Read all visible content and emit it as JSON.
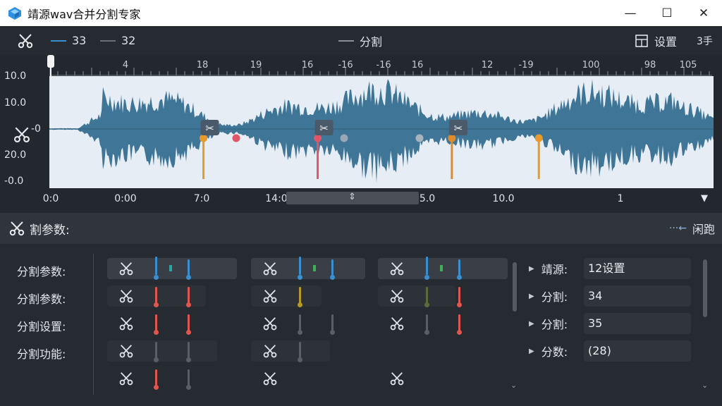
{
  "window": {
    "title": "靖源wav合并分割专家",
    "minimize": "—",
    "maximize": "☐",
    "close": "✕"
  },
  "toolbar": {
    "track_a": "33",
    "track_b": "32",
    "mode_label": "分割",
    "settings_label": "设置",
    "extra_label": "3手",
    "colors": {
      "track_a": "#3a8fd0",
      "track_b": "#6b7078"
    }
  },
  "waveform": {
    "y_labels": [
      "10.0",
      "10.0",
      "-0",
      "20.0",
      "-0.0"
    ],
    "ruler_labels": [
      "4",
      "18",
      "19",
      "16",
      "-16",
      "-16",
      "16",
      "12",
      "-19",
      "100",
      "98",
      "105"
    ],
    "x_labels": [
      "0:0",
      "0:00",
      "7:0",
      "14:0",
      "5.0",
      "10.0",
      "1"
    ],
    "wave_color": "#3f7597",
    "markers": [
      {
        "pos": 0.232,
        "color": "#e89a2a"
      },
      {
        "pos": 0.404,
        "color": "#e05567"
      },
      {
        "pos": 0.606,
        "color": "#e08a2a"
      },
      {
        "pos": 0.737,
        "color": "#e89a2a"
      }
    ]
  },
  "section": {
    "title": "割参数:",
    "right_label": "闲跑"
  },
  "params": {
    "row_labels": [
      "分割参数:",
      "分割参数:",
      "分割设置:",
      "分割功能:"
    ],
    "properties": [
      {
        "label": "靖源:",
        "value": "12设置"
      },
      {
        "label": "分割:",
        "value": "34"
      },
      {
        "label": "分割:",
        "value": "35"
      },
      {
        "label": "分数:",
        "value": "(28)"
      }
    ]
  }
}
